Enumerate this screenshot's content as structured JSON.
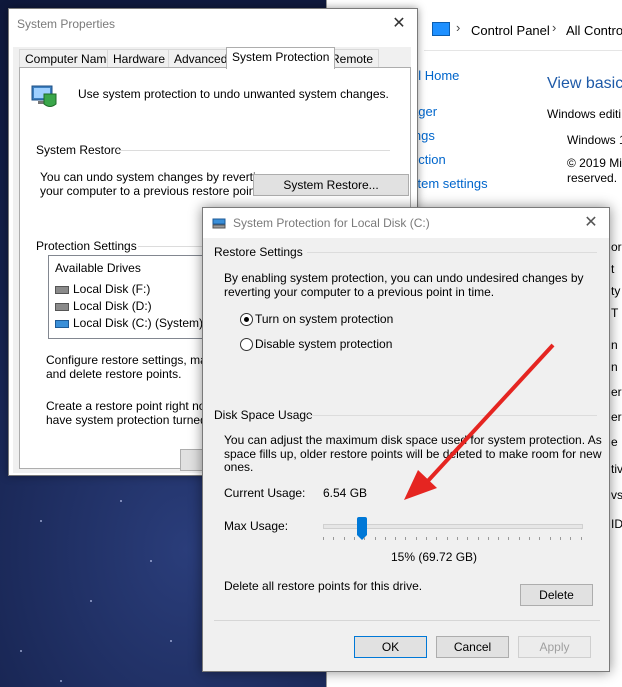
{
  "control_panel": {
    "breadcrumb_1": "Control Panel",
    "breadcrumb_2": "All Control",
    "link_home": "el Home",
    "link_manager": "ager",
    "link_settings": "ings",
    "link_protection": "ection",
    "link_system_settings": "stem settings",
    "view_basic": "View basic",
    "windows_edition": "Windows editi",
    "windows_name": "Windows 1",
    "copyright": "© 2019 Mi",
    "reserved": "reserved.",
    "side_fragments": [
      "or:",
      "t",
      "ty",
      "T",
      "n",
      "n",
      "er",
      "er",
      "e",
      "tiv",
      "vs",
      "ID"
    ]
  },
  "system_properties": {
    "title": "System Properties",
    "tabs": [
      "Computer Name",
      "Hardware",
      "Advanced",
      "System Protection",
      "Remote"
    ],
    "active_tab": "System Protection",
    "intro": "Use system protection to undo unwanted system changes.",
    "system_restore_header": "System Restore",
    "restore_desc_1": "You can undo system changes by reverting",
    "restore_desc_2": "your computer to a previous restore point.",
    "restore_button": "System Restore...",
    "protection_header": "Protection Settings",
    "drives_header": "Available Drives",
    "drives": [
      "Local Disk (F:)",
      "Local Disk (D:)",
      "Local Disk (C:) (System)"
    ],
    "configure_1": "Configure restore settings, manage",
    "configure_2": "and delete restore points.",
    "create_1": "Create a restore point right now for",
    "create_2": "have system protection turned on."
  },
  "dialog": {
    "title": "System Protection for Local Disk (C:)",
    "restore_settings_header": "Restore Settings",
    "restore_desc_1": "By enabling system protection, you can undo undesired changes by",
    "restore_desc_2": "reverting your computer to a previous point in time.",
    "option_on": "Turn on system protection",
    "option_off": "Disable system protection",
    "selected_option": "on",
    "disk_header": "Disk Space Usage",
    "disk_desc_1": "You can adjust the maximum disk space used for system protection. As",
    "disk_desc_2": "space fills up, older restore points will be deleted to make room for new",
    "disk_desc_3": "ones.",
    "current_usage_label": "Current Usage:",
    "current_usage_value": "6.54 GB",
    "max_usage_label": "Max Usage:",
    "max_usage_percent": 15,
    "max_usage_text": "15% (69.72 GB)",
    "delete_desc": "Delete all restore points for this drive.",
    "delete_button": "Delete",
    "ok_button": "OK",
    "cancel_button": "Cancel",
    "apply_button": "Apply"
  },
  "colors": {
    "accent": "#0078d7",
    "arrow": "#e52521",
    "link": "#0066cc"
  }
}
